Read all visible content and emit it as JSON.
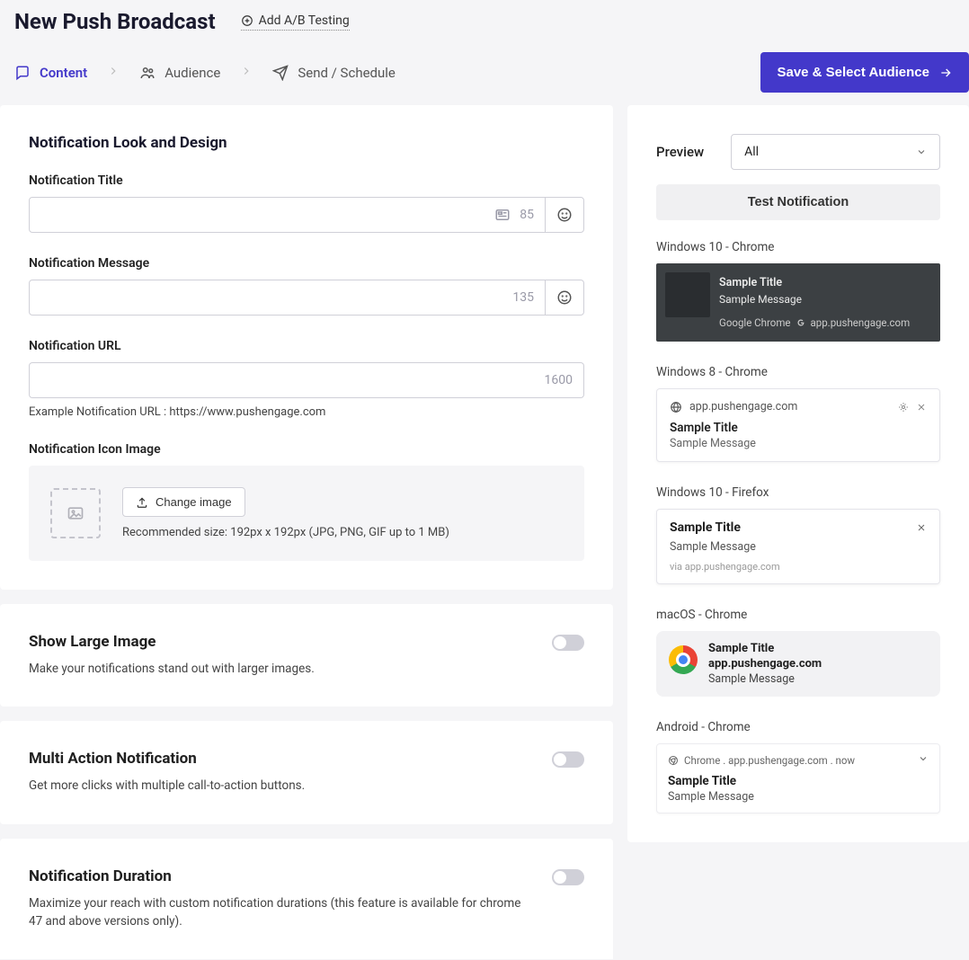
{
  "header": {
    "title": "New Push Broadcast",
    "ab_link": "Add A/B Testing"
  },
  "steps": {
    "content": "Content",
    "audience": "Audience",
    "schedule": "Send / Schedule"
  },
  "cta": "Save & Select Audience",
  "form": {
    "section_title": "Notification Look and Design",
    "title_label": "Notification Title",
    "title_count": "85",
    "message_label": "Notification Message",
    "message_count": "135",
    "url_label": "Notification URL",
    "url_count": "1600",
    "url_example": "Example Notification URL : https://www.pushengage.com",
    "icon_label": "Notification Icon Image",
    "change_image": "Change image",
    "icon_help": "Recommended size: 192px x 192px (JPG, PNG, GIF up to 1 MB)"
  },
  "toggles": {
    "large_image": {
      "title": "Show Large Image",
      "desc": "Make your notifications stand out with larger images."
    },
    "multi_action": {
      "title": "Multi Action Notification",
      "desc": "Get more clicks with multiple call-to-action buttons."
    },
    "duration": {
      "title": "Notification Duration",
      "desc": "Maximize your reach with custom notification durations (this feature is available for chrome 47 and above versions only)."
    }
  },
  "preview": {
    "label": "Preview",
    "select_value": "All",
    "test_btn": "Test Notification",
    "sample_title": "Sample Title",
    "sample_message": "Sample Message",
    "domain": "app.pushengage.com",
    "win10_chrome": {
      "label": "Windows 10 - Chrome",
      "source": "Google Chrome"
    },
    "win8_chrome": {
      "label": "Windows 8 - Chrome"
    },
    "win10_ff": {
      "label": "Windows 10 - Firefox",
      "via_prefix": "via"
    },
    "mac_chrome": {
      "label": "macOS - Chrome"
    },
    "android": {
      "label": "Android - Chrome",
      "meta": "Chrome . app.pushengage.com . now"
    }
  }
}
